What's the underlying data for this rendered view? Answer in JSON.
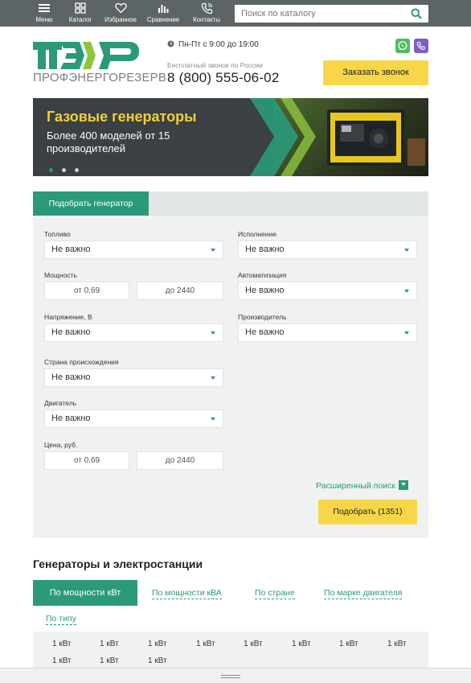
{
  "topbar": {
    "items": [
      {
        "label": "Меню",
        "icon": "hamburger-icon"
      },
      {
        "label": "Каталог",
        "icon": "grid-icon"
      },
      {
        "label": "Избранное",
        "icon": "heart-icon"
      },
      {
        "label": "Сравнение",
        "icon": "bar-chart-icon"
      },
      {
        "label": "Контакты",
        "icon": "phone-icon"
      }
    ],
    "search_placeholder": "Поиск по каталогу"
  },
  "header": {
    "logo_text": "ПРОФЭНЕРГОРЕЗЕРВ",
    "hours": "Пн-Пт с 9:00 до 19:00",
    "free_call": "Бесплатный звонок по России",
    "phone": "8 (800) 555-06-02",
    "call_button": "Заказать звонок"
  },
  "banner": {
    "title": "Газовые генераторы",
    "subtitle": "Более 400 моделей от 15 производителей",
    "slides": 3,
    "active_slide": 1
  },
  "filter": {
    "tab": "Подобрать генератор",
    "fuel_label": "Топливо",
    "fuel_value": "Не важно",
    "power_label": "Мощность",
    "power_from": "от 0.69",
    "power_to": "до 2440",
    "voltage_label": "Напряжение, В",
    "voltage_value": "Не важно",
    "country_label": "Страна происхождения",
    "country_value": "Не важно",
    "engine_label": "Двигатель",
    "engine_value": "Не важно",
    "price_label": "Цена, руб.",
    "price_from": "от 0.69",
    "price_to": "до 2440",
    "design_label": "Исполнение",
    "design_value": "Не важно",
    "automation_label": "Автоматизация",
    "automation_value": "Не важно",
    "manufacturer_label": "Производитель",
    "manufacturer_value": "Не важно",
    "advanced": "Расширенный поиск",
    "submit": "Подобрать (1351)"
  },
  "generators": {
    "title": "Генераторы и электростанции",
    "tabs": [
      "По мощности кВт",
      "По мощности кВА",
      "По стране",
      "По марке двигателя",
      "По типу"
    ],
    "active_tab": 0,
    "values": [
      "1 кВт",
      "1 кВт",
      "1 кВт",
      "1 кВт",
      "1 кВт",
      "1 кВт",
      "1 кВт",
      "1 кВт",
      "1 кВт",
      "1 кВт",
      "1 кВт"
    ]
  },
  "colors": {
    "accent_green": "#2a9a7a",
    "yellow": "#f7d748",
    "topbar": "#5d6466"
  }
}
